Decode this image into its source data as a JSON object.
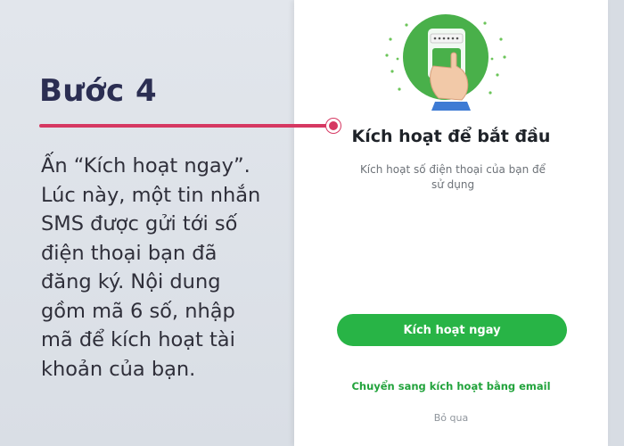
{
  "tutorial": {
    "step_title": "Bước 4",
    "description_lines": [
      "Ấn “Kích hoạt ngay”.",
      "Lúc này, một tin nhắn",
      "SMS được gửi tới số",
      "điện thoại bạn đã",
      "đăng ký. Nội dung",
      "gồm mã 6 số, nhập",
      "mã để kích hoạt tài",
      "khoản của bạn."
    ],
    "accent_color": "#d63862",
    "title_color": "#2b2e52"
  },
  "screen": {
    "illustration": "phone-in-hand-illustration",
    "title": "Kích hoạt để bắt đầu",
    "subtitle_lines": [
      "Kích hoạt số điện thoại của bạn để",
      "sử dụng"
    ],
    "activate_button": "Kích hoạt ngay",
    "email_link": "Chuyển sang kích hoạt bằng email",
    "skip_link": "Bỏ qua",
    "brand_color": "#28b446"
  }
}
